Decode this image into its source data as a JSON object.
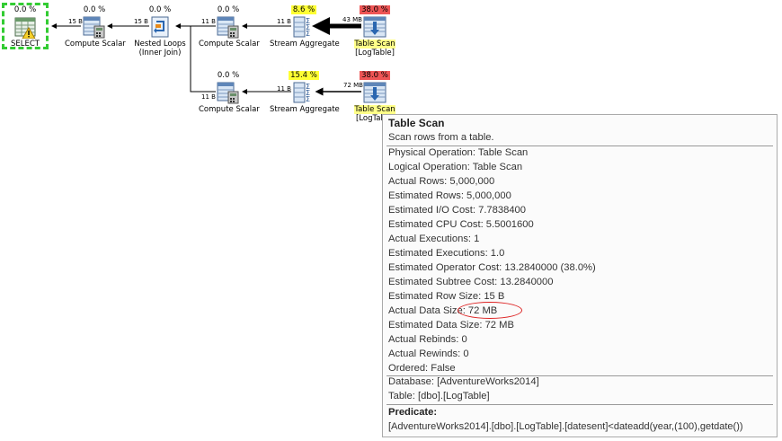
{
  "plan": {
    "select": {
      "pct": "0.0 %",
      "label": "SELECT"
    },
    "compute1": {
      "pct": "0.0 %",
      "label": "Compute Scalar"
    },
    "nested": {
      "pct": "0.0 %",
      "label": "Nested Loops",
      "sublabel": "(Inner Join)"
    },
    "compute2": {
      "pct": "0.0 %",
      "label": "Compute Scalar"
    },
    "stream1": {
      "pct": "8.6 %",
      "label": "Stream Aggregate"
    },
    "scan1": {
      "pct": "38.0 %",
      "label": "Table Scan",
      "sublabel": "[LogTable]"
    },
    "compute3": {
      "pct": "0.0 %",
      "label": "Compute Scalar"
    },
    "stream2": {
      "pct": "15.4 %",
      "label": "Stream Aggregate"
    },
    "scan2": {
      "pct": "38.0 %",
      "label": "Table Scan",
      "sublabel": "[LogTab"
    },
    "edges": {
      "e1": "15 B",
      "e2": "15 B",
      "e3": "11 B",
      "e4": "11 B",
      "e5": "43 MB",
      "e6": "11 B",
      "e7": "11 B",
      "e8": "72 MB"
    }
  },
  "tooltip": {
    "title": "Table Scan",
    "description": "Scan rows from a table.",
    "properties": [
      "Physical Operation:  Table Scan",
      "Logical Operation:  Table Scan",
      "Actual Rows:  5,000,000",
      "Estimated Rows:  5,000,000",
      "Estimated I/O Cost:  7.7838400",
      "Estimated CPU Cost:  5.5001600",
      "Actual Executions:  1",
      "Estimated Executions:  1.0",
      "Estimated Operator Cost:  13.2840000 (38.0%)",
      "Estimated Subtree Cost:  13.2840000",
      "Estimated Row Size:  15 B",
      "Actual Data Size:  72 MB",
      "Estimated Data Size:  72 MB",
      "Actual Rebinds:  0",
      "Actual Rewinds:  0",
      "Ordered:  False"
    ],
    "database": "Database:  [AdventureWorks2014]",
    "table": "Table:  [dbo].[LogTable]",
    "predicate_header": "Predicate:",
    "predicate": "[AdventureWorks2014].[dbo].[LogTable].[datesent]<dateadd(year,(100),getdate())"
  },
  "colors": {
    "select_border": "#33cc33",
    "pct_yellow": "#ffff33",
    "pct_red": "#ee5555",
    "annotation": "#dd2222"
  }
}
